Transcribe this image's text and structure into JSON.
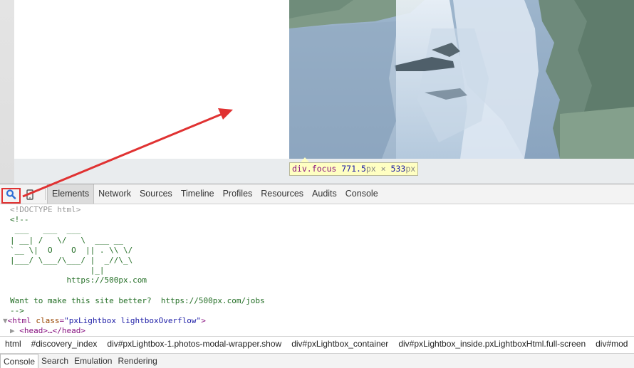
{
  "tooltip": {
    "selector": "div.focus",
    "width": "771.5",
    "height": "533",
    "unit": "px",
    "times": "×"
  },
  "toolbar": {
    "search_icon": "magnifier-icon",
    "device_icon": "mobile-device-icon",
    "tabs": [
      "Elements",
      "Network",
      "Sources",
      "Timeline",
      "Profiles",
      "Resources",
      "Audits",
      "Console"
    ],
    "active_tab": "Elements"
  },
  "code": {
    "doctype": "<!DOCTYPE html>",
    "comment_open": "<!--",
    "ascii_art": [
      " ___   ___  ___",
      "| __| /   \\/   \\  ___ __",
      "`__ \\|  O    O  || . \\\\ \\/",
      "|___/ \\___/\\___/ |  _//\\_\\",
      "                 |_|",
      "            https://500px.com"
    ],
    "blank": "",
    "better": "Want to make this site better?  https://500px.com/jobs",
    "comment_close": "-->",
    "html_tag_open": "<html",
    "html_attr_name": "class",
    "html_attr_value": "\"pxLightbox lightboxOverflow\"",
    "html_tag_close": ">",
    "head_tag": "<head>…</head>"
  },
  "breadcrumbs": [
    "html",
    "#discovery_index",
    "div#pxLightbox-1.photos-modal-wrapper.show",
    "div#pxLightbox_container",
    "div#pxLightbox_inside.pxLightboxHtml.full-screen",
    "div#mod"
  ],
  "drawer": {
    "tabs": [
      "Console",
      "Search",
      "Emulation",
      "Rendering"
    ],
    "active_tab": "Console"
  },
  "colors": {
    "annotation_red": "#e03232",
    "tooltip_bg": "#ffffc2",
    "tag": "#881280",
    "comment": "#236e25"
  }
}
